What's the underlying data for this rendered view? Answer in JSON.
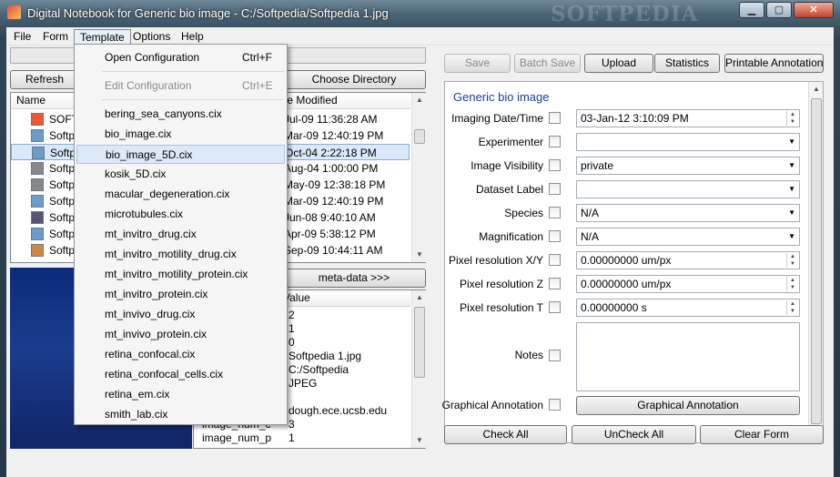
{
  "window": {
    "title": "Digital Notebook for Generic bio image - C:/Softpedia/Softpedia 1.jpg",
    "watermark": "SOFTPEDIA",
    "minimize": "▁",
    "maximize": "▢",
    "close": "✕"
  },
  "menubar": [
    "File",
    "Form",
    "Template",
    "Options",
    "Help"
  ],
  "left": {
    "refresh": "Refresh",
    "choose_dir": "Choose Directory",
    "col_name": "Name",
    "col_date": "te Modified",
    "files": [
      {
        "name": "SOFT",
        "date": "Jul-09 11:36:28 AM"
      },
      {
        "name": "Softp",
        "date": "Mar-09 12:40:19 PM"
      },
      {
        "name": "Softp",
        "date": "Oct-04 2:22:18 PM"
      },
      {
        "name": "Softp",
        "date": "Aug-04 1:00:00 PM"
      },
      {
        "name": "Softp",
        "date": "May-09 12:38:18 PM"
      },
      {
        "name": "Softp",
        "date": "Mar-09 12:40:19 PM"
      },
      {
        "name": "Softp",
        "date": "Jun-08 9:40:10 AM"
      },
      {
        "name": "Softp",
        "date": "Apr-09 5:38:12 PM"
      },
      {
        "name": "Softp",
        "date": "Sep-09 10:44:11 AM"
      }
    ],
    "meta_btn": "meta-data >>>",
    "meta_col_value": "Value",
    "meta_rows": [
      {
        "key": "",
        "value": "2"
      },
      {
        "key": "",
        "value": "1"
      },
      {
        "key": "",
        "value": "0"
      },
      {
        "key": "",
        "value": "Softpedia 1.jpg"
      },
      {
        "key": "",
        "value": "C:/Softpedia"
      },
      {
        "key": "",
        "value": "JPEG"
      },
      {
        "key": "",
        "value": ""
      },
      {
        "key": "",
        "value": "dough.ece.ucsb.edu"
      },
      {
        "key": "image_num_c",
        "value": "3"
      },
      {
        "key": "image_num_p",
        "value": "1"
      }
    ]
  },
  "template_menu": {
    "open_config": "Open Configuration",
    "open_sc": "Ctrl+F",
    "edit_config": "Edit Configuration",
    "edit_sc": "Ctrl+E",
    "items": [
      "bering_sea_canyons.cix",
      "bio_image.cix",
      "bio_image_5D.cix",
      "kosik_5D.cix",
      "macular_degeneration.cix",
      "microtubules.cix",
      "mt_invitro_drug.cix",
      "mt_invitro_motility_drug.cix",
      "mt_invitro_motility_protein.cix",
      "mt_invitro_protein.cix",
      "mt_invivo_drug.cix",
      "mt_invivo_protein.cix",
      "retina_confocal.cix",
      "retina_confocal_cells.cix",
      "retina_em.cix",
      "smith_lab.cix"
    ]
  },
  "toolbar": {
    "save": "Save",
    "batch_save": "Batch Save",
    "upload": "Upload",
    "statistics": "Statistics",
    "printable": "Printable Annotations"
  },
  "form": {
    "title": "Generic bio image",
    "fields": [
      {
        "label": "Imaging Date/Time",
        "value": "03-Jan-12 3:10:09 PM"
      },
      {
        "label": "Experimenter",
        "value": ""
      },
      {
        "label": "Image Visibility",
        "value": "private"
      },
      {
        "label": "Dataset Label",
        "value": ""
      },
      {
        "label": "Species",
        "value": "N/A"
      },
      {
        "label": "Magnification",
        "value": "N/A"
      },
      {
        "label": "Pixel resolution X/Y",
        "value": "0.00000000 um/px"
      },
      {
        "label": "Pixel resolution Z",
        "value": "0.00000000 um/px"
      },
      {
        "label": "Pixel resolution T",
        "value": "0.00000000 s"
      },
      {
        "label": "Notes",
        "value": ""
      },
      {
        "label": "Graphical Annotation",
        "value": "Graphical Annotation"
      }
    ]
  },
  "bottom": {
    "check_all": "Check All",
    "uncheck_all": "UnCheck All",
    "clear_form": "Clear Form"
  },
  "colors": {
    "title_text": "#ffffff",
    "form_title": "#1a3f9c",
    "selection": "#d9e9fb"
  }
}
